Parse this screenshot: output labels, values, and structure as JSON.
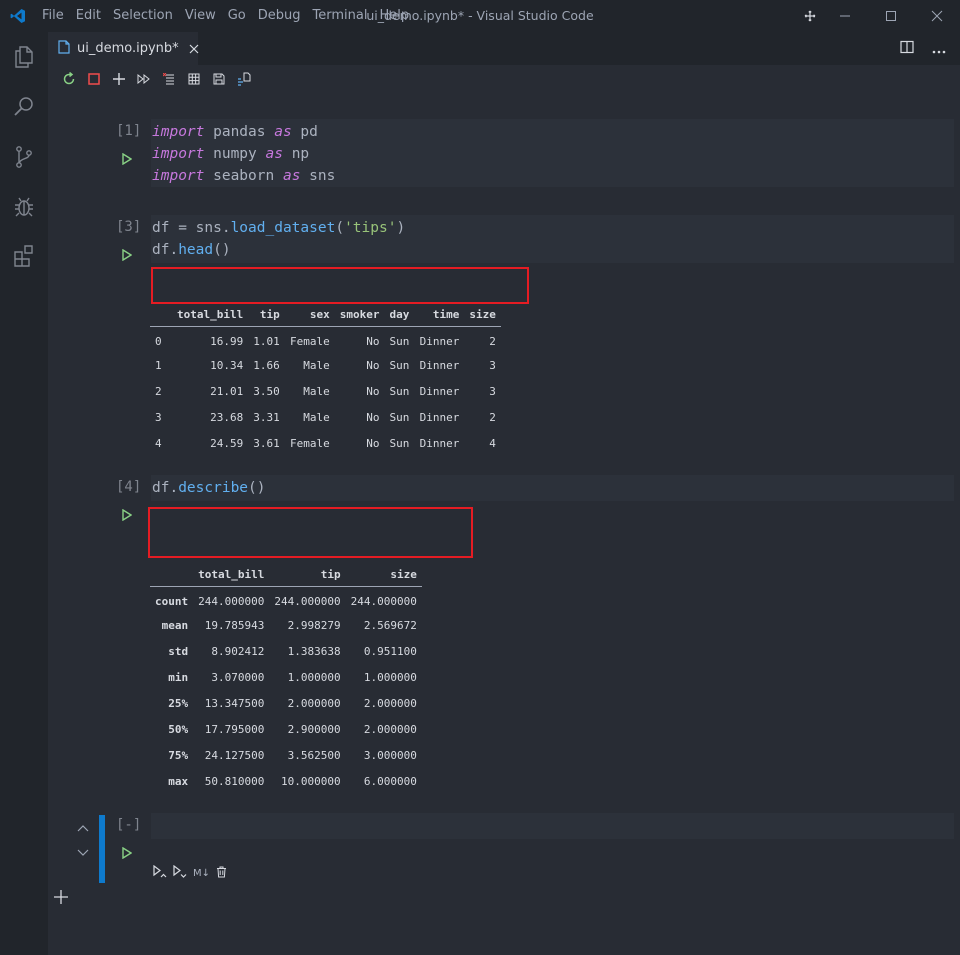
{
  "window": {
    "title": "ui_demo.ipynb* - Visual Studio Code",
    "menu": [
      "File",
      "Edit",
      "Selection",
      "View",
      "Go",
      "Debug",
      "Terminal",
      "Help"
    ]
  },
  "tab": {
    "label": "ui_demo.ipynb*"
  },
  "notebook": {
    "cells": [
      {
        "prompt": "[1]",
        "code": [
          "import pandas as pd",
          "import numpy as np",
          "import seaborn as sns"
        ]
      },
      {
        "prompt": "[3]",
        "code": [
          "df = sns.load_dataset('tips')",
          "df.head()"
        ]
      },
      {
        "prompt": "[4]",
        "code": [
          "df.describe()"
        ]
      },
      {
        "prompt": "[-]",
        "code": []
      }
    ],
    "head_table": {
      "columns": [
        "",
        "total_bill",
        "tip",
        "sex",
        "smoker",
        "day",
        "time",
        "size"
      ],
      "rows": [
        [
          "0",
          "16.99",
          "1.01",
          "Female",
          "No",
          "Sun",
          "Dinner",
          "2"
        ],
        [
          "1",
          "10.34",
          "1.66",
          "Male",
          "No",
          "Sun",
          "Dinner",
          "3"
        ],
        [
          "2",
          "21.01",
          "3.50",
          "Male",
          "No",
          "Sun",
          "Dinner",
          "3"
        ],
        [
          "3",
          "23.68",
          "3.31",
          "Male",
          "No",
          "Sun",
          "Dinner",
          "2"
        ],
        [
          "4",
          "24.59",
          "3.61",
          "Female",
          "No",
          "Sun",
          "Dinner",
          "4"
        ]
      ]
    },
    "describe_table": {
      "columns": [
        "",
        "total_bill",
        "tip",
        "size"
      ],
      "rows": [
        [
          "count",
          "244.000000",
          "244.000000",
          "244.000000"
        ],
        [
          "mean",
          "19.785943",
          "2.998279",
          "2.569672"
        ],
        [
          "std",
          "8.902412",
          "1.383638",
          "0.951100"
        ],
        [
          "min",
          "3.070000",
          "1.000000",
          "1.000000"
        ],
        [
          "25%",
          "13.347500",
          "2.000000",
          "2.000000"
        ],
        [
          "50%",
          "17.795000",
          "2.900000",
          "2.000000"
        ],
        [
          "75%",
          "24.127500",
          "3.562500",
          "3.000000"
        ],
        [
          "max",
          "50.810000",
          "10.000000",
          "6.000000"
        ]
      ]
    },
    "markdown_label": "M↓"
  },
  "colors": {
    "background": "#282c34",
    "chrome": "#21252b",
    "code_bg": "#2c313a",
    "keyword": "#c678dd",
    "function": "#61afef",
    "string": "#98c379",
    "run_green": "#89d185",
    "highlight_red": "#e51c23",
    "selected_cell": "#0e7acc"
  }
}
